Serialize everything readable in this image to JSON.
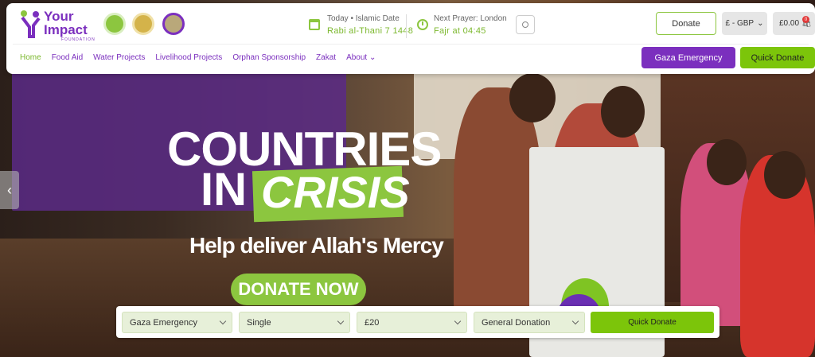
{
  "logo": {
    "line1": "Your",
    "line2": "Impact",
    "sub": "FOUNDATION"
  },
  "header": {
    "date_label": "Today • Islamic Date",
    "date_value": "Rabi al-Thani 7 1448",
    "prayer_label": "Next Prayer: London",
    "prayer_value": "Fajr at 04:45",
    "donate_label": "Donate",
    "currency_label": "£ - GBP",
    "cart_total": "£0.00",
    "cart_count": "0"
  },
  "nav": {
    "items": [
      "Home",
      "Food Aid",
      "Water Projects",
      "Livelihood Projects",
      "Orphan Sponsorship",
      "Zakat",
      "About"
    ],
    "gaza_label": "Gaza Emergency",
    "quick_label": "Quick Donate"
  },
  "hero": {
    "line1": "COUNTRIES",
    "line2a": "IN",
    "line2b": "CRISIS",
    "subtitle": "Help deliver Allah's Mercy",
    "cta": "DONATE NOW"
  },
  "form": {
    "campaign": "Gaza Emergency",
    "frequency": "Single",
    "amount": "£20",
    "type": "General Donation",
    "submit": "Quick Donate"
  },
  "colors": {
    "purple": "#7b2fbe",
    "green": "#7cc50a"
  }
}
